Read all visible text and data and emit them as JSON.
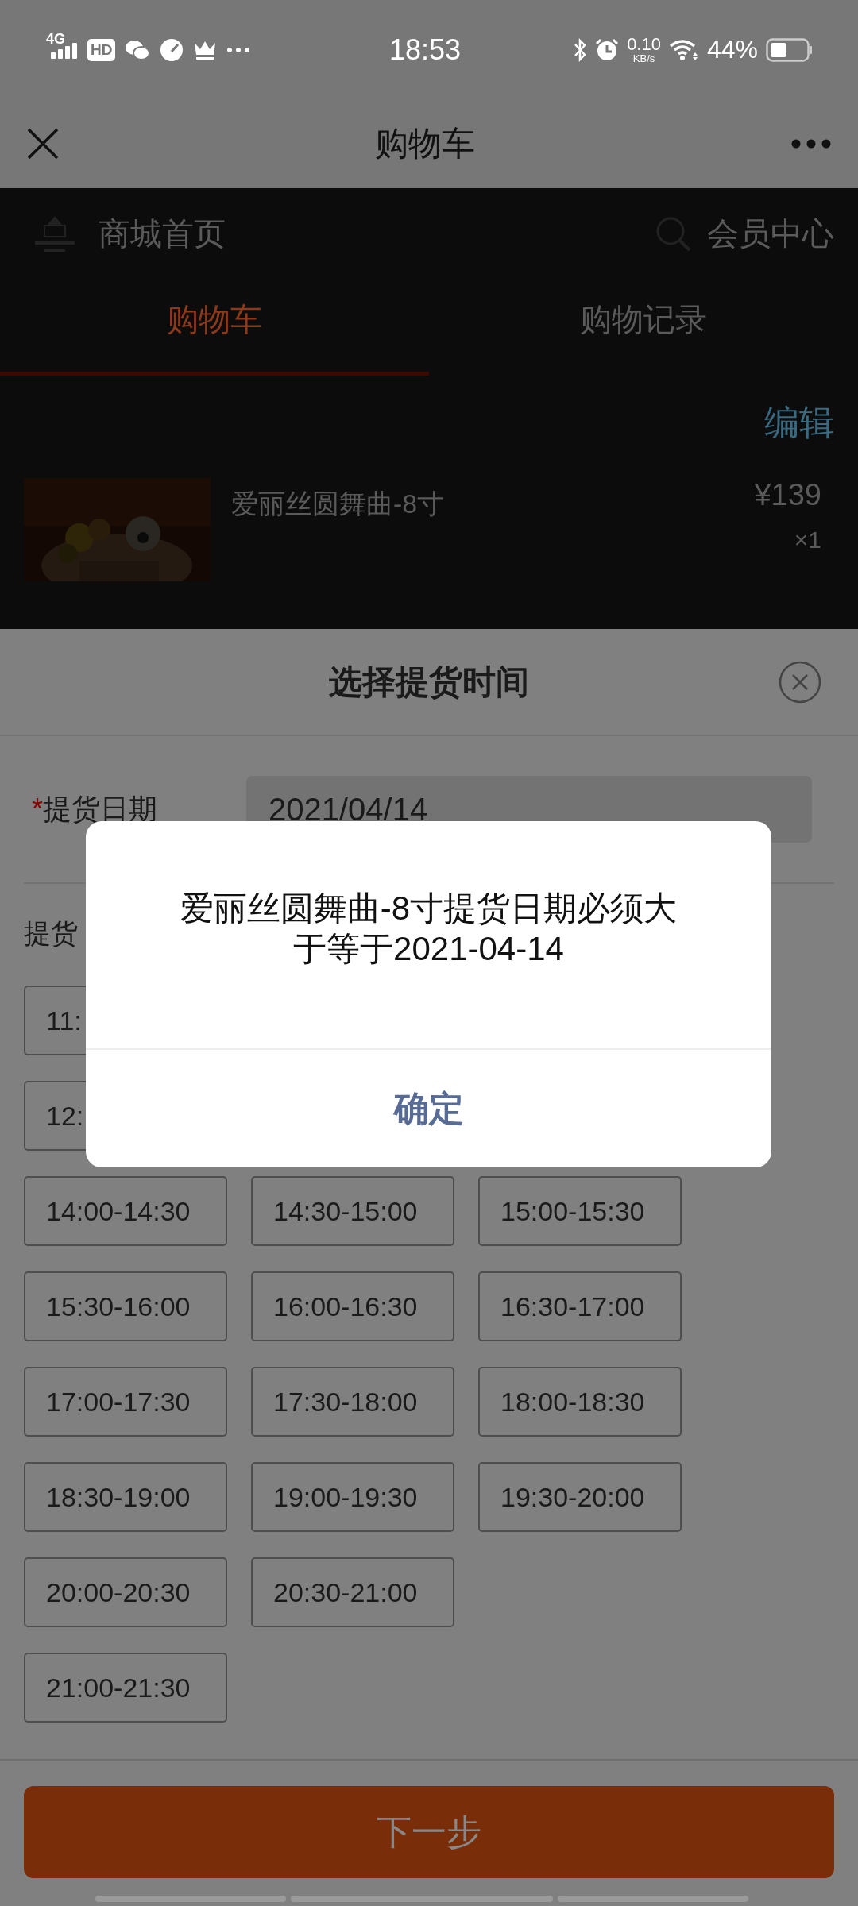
{
  "status_bar": {
    "network": "4G",
    "hd": "HD",
    "time": "18:53",
    "net_speed": "0.10",
    "net_unit": "KB/s",
    "battery": "44%"
  },
  "nav": {
    "title": "购物车"
  },
  "store": {
    "home": "商城首页",
    "member": "会员中心",
    "edit": "编辑",
    "tabs": [
      {
        "label": "购物车",
        "selected": true
      },
      {
        "label": "购物记录",
        "selected": false
      }
    ],
    "item": {
      "name": "爱丽丝圆舞曲-8寸",
      "price": "¥139",
      "qty": "×1"
    }
  },
  "sheet": {
    "title": "选择提货时间",
    "required_mark": "*",
    "date_label": "提货日期",
    "date_value": "2021/04/14",
    "time_label": "提货",
    "slot_rows": [
      [
        "11:"
      ],
      [
        "12:"
      ],
      [
        "14:00-14:30",
        "14:30-15:00",
        "15:00-15:30"
      ],
      [
        "15:30-16:00",
        "16:00-16:30",
        "16:30-17:00"
      ],
      [
        "17:00-17:30",
        "17:30-18:00",
        "18:00-18:30"
      ],
      [
        "18:30-19:00",
        "19:00-19:30",
        "19:30-20:00"
      ],
      [
        "20:00-20:30",
        "20:30-21:00"
      ],
      [
        "21:00-21:30"
      ]
    ],
    "next_button": "下一步"
  },
  "dialog": {
    "message": "爱丽丝圆舞曲-8寸提货日期必须大于等于2021-04-14",
    "button": "确定"
  }
}
